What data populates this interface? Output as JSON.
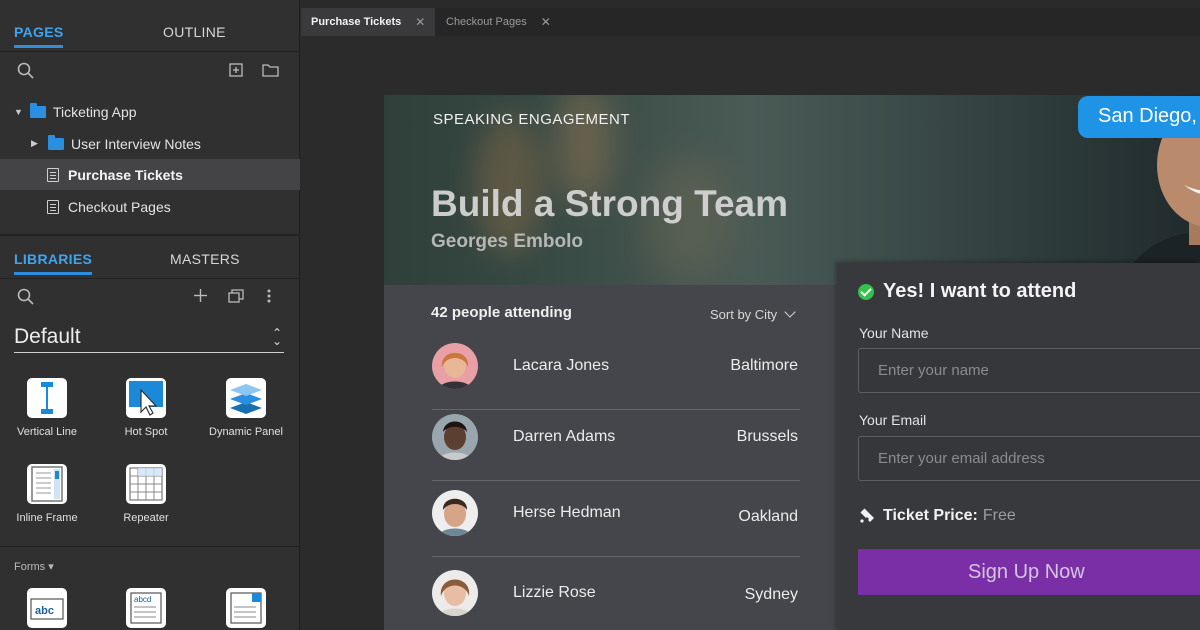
{
  "sidebar": {
    "top_tabs": [
      {
        "label": "PAGES"
      },
      {
        "label": "OUTLINE"
      }
    ],
    "tree": [
      {
        "label": "Ticketing App",
        "type": "folder"
      },
      {
        "label": "User Interview Notes",
        "type": "folder"
      },
      {
        "label": "Purchase Tickets",
        "type": "page",
        "selected": true
      },
      {
        "label": "Checkout Pages",
        "type": "page"
      }
    ],
    "lib_tabs": [
      {
        "label": "LIBRARIES"
      },
      {
        "label": "MASTERS"
      }
    ],
    "library_name": "Default",
    "widgets": [
      {
        "label": "Vertical Line",
        "icon": "vertical-line-icon"
      },
      {
        "label": "Hot Spot",
        "icon": "hot-spot-icon"
      },
      {
        "label": "Dynamic Panel",
        "icon": "dynamic-panel-icon"
      },
      {
        "label": "Inline Frame",
        "icon": "inline-frame-icon"
      },
      {
        "label": "Repeater",
        "icon": "repeater-icon"
      }
    ],
    "forms_label": "Forms ▾",
    "form_widget_icons": [
      "text-field-icon",
      "text-area-icon",
      "droplist-icon"
    ]
  },
  "tabs": [
    {
      "label": "Purchase Tickets",
      "active": true
    },
    {
      "label": "Checkout Pages",
      "active": false
    }
  ],
  "hero": {
    "eyebrow": "SPEAKING ENGAGEMENT",
    "title": "Build a Strong Team",
    "speaker": "Georges Embolo",
    "city": "San Diego,"
  },
  "attendees": {
    "count_label": "42 people attending",
    "sort_label": "Sort by City",
    "rows": [
      {
        "name": "Lacara Jones",
        "city": "Baltimore",
        "color": "#e0a489"
      },
      {
        "name": "Darren Adams",
        "city": "Brussels",
        "color": "#5b4638"
      },
      {
        "name": "Herse Hedman",
        "city": "Oakland",
        "color": "#c59a80"
      },
      {
        "name": "Lizzie Rose",
        "city": "Sydney",
        "color": "#d8b09c"
      }
    ]
  },
  "form": {
    "heading": "Yes! I want to attend",
    "name_label": "Your Name",
    "name_placeholder": "Enter your name",
    "email_label": "Your Email",
    "email_placeholder": "Enter your email address",
    "price_label": "Ticket Price:",
    "price_value": "Free",
    "submit_label": "Sign Up Now"
  },
  "colors": {
    "accent": "#2f8ee0",
    "signup": "#7a2fa6",
    "city_badge": "#1f93e5",
    "check": "#33c24a"
  }
}
